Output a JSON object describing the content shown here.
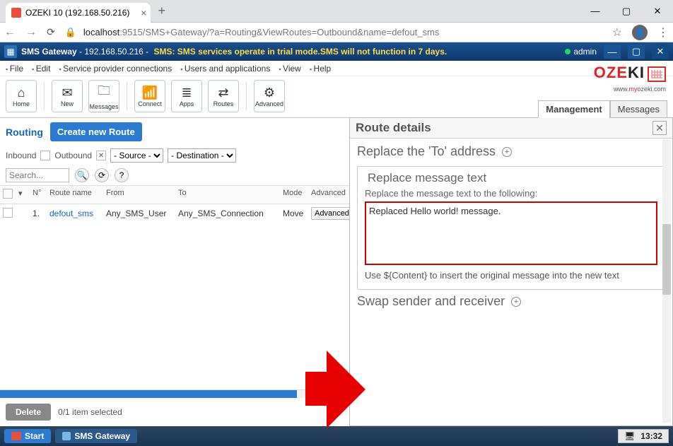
{
  "browser": {
    "tab_title": "OZEKI 10 (192.168.50.216)",
    "url_host": "localhost",
    "url_port_path": ":9515/SMS+Gateway/?a=Routing&ViewRoutes=Outbound&name=defout_sms"
  },
  "app_header": {
    "title": "SMS Gateway",
    "ip": "192.168.50.216",
    "trial_msg": "SMS: SMS services operate in trial mode.SMS will not function in 7 days.",
    "user": "admin"
  },
  "menu": [
    "File",
    "Edit",
    "Service provider connections",
    "Users and applications",
    "View",
    "Help"
  ],
  "logo": {
    "text_red": "OZE",
    "text_black": "KI",
    "url_pre": "www.",
    "url_mid": "my",
    "url_post": "ozeki.com"
  },
  "toolbar": [
    {
      "label": "Home",
      "icon": "⌂"
    },
    {
      "label": "New",
      "icon": "✉"
    },
    {
      "label": "Messages",
      "icon": "🗀"
    },
    {
      "label": "Connect",
      "icon": "📶"
    },
    {
      "label": "Apps",
      "icon": "≣"
    },
    {
      "label": "Routes",
      "icon": "⇄"
    },
    {
      "label": "Advanced",
      "icon": "⚙"
    }
  ],
  "right_tabs": {
    "management": "Management",
    "messages": "Messages"
  },
  "left": {
    "routing": "Routing",
    "create": "Create new Route",
    "inbound": "Inbound",
    "outbound": "Outbound",
    "source_placeholder": "- Source -",
    "dest_placeholder": "- Destination -",
    "search_placeholder": "Search...",
    "cols": {
      "n": "N°",
      "name": "Route name",
      "from": "From",
      "to": "To",
      "mode": "Mode",
      "adv": "Advanced"
    },
    "row": {
      "n": "1.",
      "name": "defout_sms",
      "from": "Any_SMS_User",
      "to": "Any_SMS_Connection",
      "mode": "Move",
      "adv": "Advanced"
    },
    "delete": "Delete",
    "selected": "0/1 item selected"
  },
  "right": {
    "title": "Route details",
    "replace_to": "Replace the 'To' address",
    "replace_msg_legend": "Replace message text",
    "replace_msg_label": "Replace the message text to the following:",
    "msg_value": "Replaced Hello world! message.",
    "hint": "Use ${Content} to insert the original message into the new text",
    "swap": "Swap sender and receiver"
  },
  "taskbar": {
    "start": "Start",
    "app": "SMS Gateway",
    "time": "13:32"
  }
}
